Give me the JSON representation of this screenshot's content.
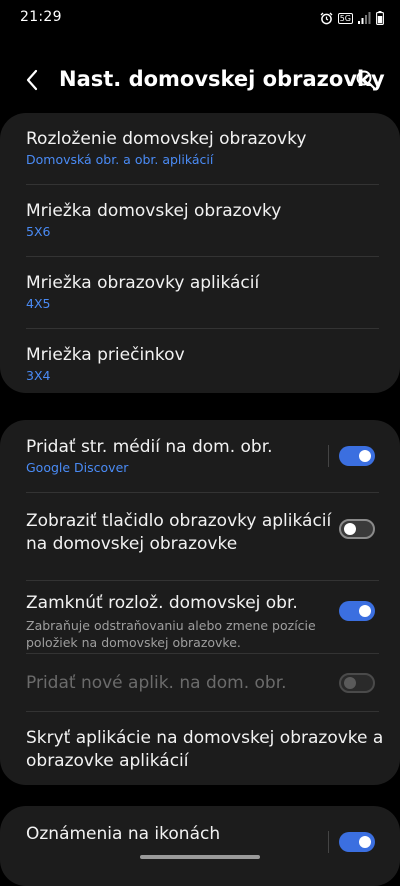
{
  "status_bar": {
    "time": "21:29",
    "network_badge": "5G"
  },
  "header": {
    "title": "Nast. domovskej obrazovky"
  },
  "section_layout": {
    "items": [
      {
        "title": "Rozloženie domovskej obrazovky",
        "subtitle": "Domovská obr. a obr. aplikácií"
      },
      {
        "title": "Mriežka domovskej obrazovky",
        "subtitle": "5X6"
      },
      {
        "title": "Mriežka obrazovky aplikácií",
        "subtitle": "4X5"
      },
      {
        "title": "Mriežka priečinkov",
        "subtitle": "3X4"
      }
    ]
  },
  "section_toggles": {
    "items": [
      {
        "title": "Pridať str. médií na dom. obr.",
        "subtitle": "Google Discover",
        "toggle": "on"
      },
      {
        "title_line1": "Zobraziť tlačidlo obrazovky aplikácií",
        "title_line2": "na domovskej obrazovke",
        "toggle": "off"
      },
      {
        "title": "Zamknúť rozlož. domovskej obr.",
        "desc_line1": "Zabraňuje odstraňovaniu alebo zmene pozície",
        "desc_line2": "položiek na domovskej obrazovke.",
        "toggle": "on"
      },
      {
        "title": "Pridať nové aplik. na dom. obr.",
        "toggle": "disabled"
      },
      {
        "title_line1": "Skryť aplikácie na domovskej obrazovke a",
        "title_line2": "obrazovke aplikácií"
      }
    ]
  },
  "section_badges": {
    "items": [
      {
        "title": "Oznámenia na ikonách",
        "toggle": "on"
      }
    ]
  },
  "colors": {
    "background": "#000000",
    "card": "#1c1c1c",
    "accent": "#3b6fe0",
    "subtitle": "#4a8bf5"
  }
}
